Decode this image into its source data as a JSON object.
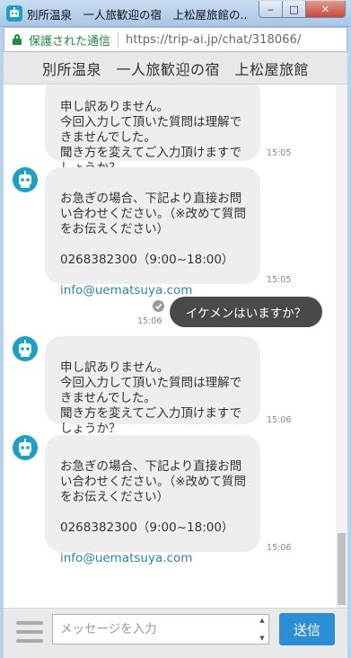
{
  "window": {
    "title": "別所温泉　一人旅歓迎の宿　上松屋旅館の...",
    "minimize": "‒",
    "maximize": "□",
    "close": "✕"
  },
  "addressbar": {
    "secure_label": "保護された通信",
    "url": "https://trip-ai.jp/chat/318066/"
  },
  "chat": {
    "header_title": "別所温泉　一人旅歓迎の宿　上松屋旅館",
    "messages": [
      {
        "from": "bot",
        "text": "申し訳ありません。\n今回入力して頂いた質問は理解できませんでした。\n聞き方を変えてご入力頂けますでしょうか？",
        "time": "15:05"
      },
      {
        "from": "bot",
        "text": "お急ぎの場合、下記より直接お問い合わせください。（※改めて質問をお伝えください）\n\n0268382300（9:00~18:00）\n",
        "email": "info@uematsuya.com",
        "time": "15:05"
      },
      {
        "from": "user",
        "text": "イケメンはいますか？",
        "time": "15:06"
      },
      {
        "from": "bot",
        "text": "申し訳ありません。\n今回入力して頂いた質問は理解できませんでした。\n聞き方を変えてご入力頂けますでしょうか？",
        "time": "15:06"
      },
      {
        "from": "bot",
        "text": "お急ぎの場合、下記より直接お問い合わせください。（※改めて質問をお伝えください）\n\n0268382300（9:00~18:00）\n",
        "email": "info@uematsuya.com",
        "time": "15:06"
      }
    ]
  },
  "input": {
    "placeholder": "メッセージを入力",
    "send_label": "送信"
  },
  "colors": {
    "bot_avatar": "#1ba1c6",
    "user_bubble": "#4a4a4a",
    "send_button": "#2c8fd6",
    "email_link": "#2f7ec6"
  },
  "icons": {
    "app": "robot-icon",
    "lock": "lock-icon",
    "menu": "hamburger-menu-icon",
    "read": "check-icon"
  }
}
